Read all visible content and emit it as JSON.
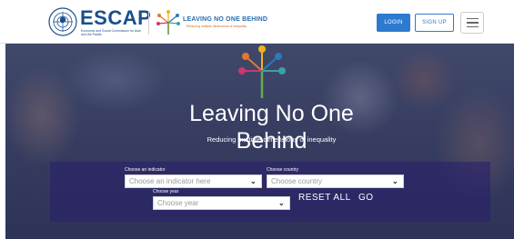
{
  "header": {
    "brand_name": "ESCAP",
    "brand_sub": "Economic and Social Commission for Asia and the Pacific",
    "program_title": "LEAVING NO ONE BEHIND",
    "program_sub": "Reducing multiple dimensions of inequality",
    "login_label": "LOGIN",
    "signup_label": "SIGN UP",
    "menu_icon": "hamburger-menu-icon",
    "colors": {
      "brand_blue": "#1a4e8c",
      "button_blue": "#2e7ad1",
      "accent_orange": "#d36b1f"
    }
  },
  "hero": {
    "title": "Leaving No One Behind",
    "subtitle": "Reducing multiple dimensions of inequality"
  },
  "filters": {
    "indicator_label": "Choose an indicator",
    "indicator_placeholder": "Choose an indicator here",
    "country_label": "Choose country",
    "country_placeholder": "Choose country",
    "year_label": "Choose year",
    "year_placeholder": "Choose year",
    "reset_label": "RESET ALL",
    "go_label": "GO"
  }
}
